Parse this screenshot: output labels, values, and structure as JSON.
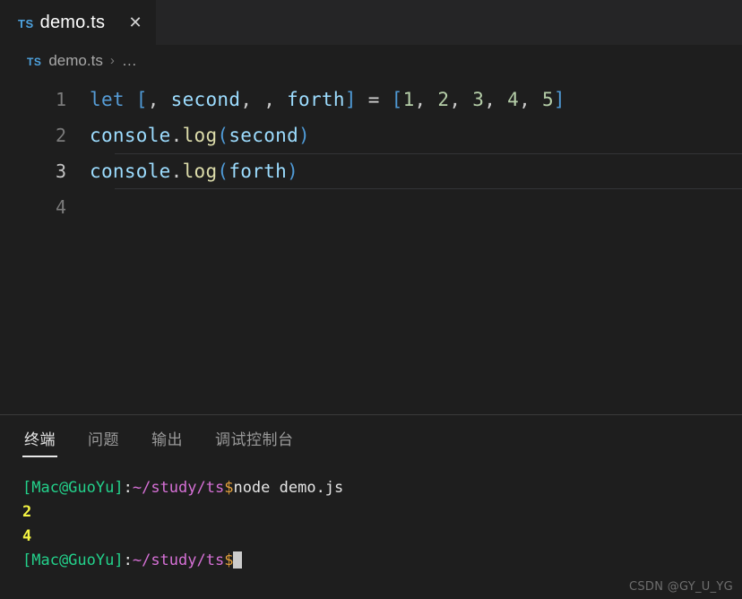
{
  "tabbar": {
    "tabs": [
      {
        "badge": "TS",
        "title": "demo.ts",
        "close": "✕"
      }
    ]
  },
  "breadcrumb": {
    "badge": "TS",
    "file": "demo.ts",
    "separator": "›",
    "more": "…"
  },
  "editor": {
    "lines": [
      {
        "number": "1",
        "active": false,
        "tokens": [
          {
            "text": "let",
            "cls": "tok-kw"
          },
          {
            "text": " ",
            "cls": "tok-op"
          },
          {
            "text": "[",
            "cls": "tok-brk"
          },
          {
            "text": ", ",
            "cls": "tok-punct"
          },
          {
            "text": "second",
            "cls": "tok-var"
          },
          {
            "text": ", , ",
            "cls": "tok-punct"
          },
          {
            "text": "forth",
            "cls": "tok-var"
          },
          {
            "text": "]",
            "cls": "tok-brk"
          },
          {
            "text": " ",
            "cls": "tok-op"
          },
          {
            "text": "=",
            "cls": "tok-op"
          },
          {
            "text": " ",
            "cls": "tok-op"
          },
          {
            "text": "[",
            "cls": "tok-brk"
          },
          {
            "text": "1",
            "cls": "tok-num"
          },
          {
            "text": ", ",
            "cls": "tok-punct"
          },
          {
            "text": "2",
            "cls": "tok-num"
          },
          {
            "text": ", ",
            "cls": "tok-punct"
          },
          {
            "text": "3",
            "cls": "tok-num"
          },
          {
            "text": ", ",
            "cls": "tok-punct"
          },
          {
            "text": "4",
            "cls": "tok-num"
          },
          {
            "text": ", ",
            "cls": "tok-punct"
          },
          {
            "text": "5",
            "cls": "tok-num"
          },
          {
            "text": "]",
            "cls": "tok-brk"
          }
        ]
      },
      {
        "number": "2",
        "active": false,
        "tokens": [
          {
            "text": "console",
            "cls": "tok-var"
          },
          {
            "text": ".",
            "cls": "tok-dot"
          },
          {
            "text": "log",
            "cls": "tok-fn"
          },
          {
            "text": "(",
            "cls": "tok-brk"
          },
          {
            "text": "second",
            "cls": "tok-var"
          },
          {
            "text": ")",
            "cls": "tok-brk"
          }
        ]
      },
      {
        "number": "3",
        "active": true,
        "tokens": [
          {
            "text": "console",
            "cls": "tok-var"
          },
          {
            "text": ".",
            "cls": "tok-dot"
          },
          {
            "text": "log",
            "cls": "tok-fn"
          },
          {
            "text": "(",
            "cls": "tok-brk"
          },
          {
            "text": "forth",
            "cls": "tok-var"
          },
          {
            "text": ")",
            "cls": "tok-brk"
          }
        ]
      },
      {
        "number": "4",
        "active": false,
        "tokens": []
      }
    ]
  },
  "panel": {
    "tabs": [
      {
        "label": "终端",
        "active": true
      },
      {
        "label": "问题",
        "active": false
      },
      {
        "label": "输出",
        "active": false
      },
      {
        "label": "调试控制台",
        "active": false
      }
    ],
    "terminal": {
      "lines": [
        {
          "segments": [
            {
              "text": "[Mac@GuoYu]",
              "cls": "t-green"
            },
            {
              "text": ":",
              "cls": "t-white"
            },
            {
              "text": "~/study/ts",
              "cls": "t-magenta"
            },
            {
              "text": "$",
              "cls": "t-dollar"
            },
            {
              "text": "node demo.js",
              "cls": "t-white"
            }
          ],
          "cursor": false
        },
        {
          "segments": [
            {
              "text": "2",
              "cls": "t-yellow"
            }
          ],
          "cursor": false
        },
        {
          "segments": [
            {
              "text": "4",
              "cls": "t-yellow"
            }
          ],
          "cursor": false
        },
        {
          "segments": [
            {
              "text": "[Mac@GuoYu]",
              "cls": "t-green"
            },
            {
              "text": ":",
              "cls": "t-white"
            },
            {
              "text": "~/study/ts",
              "cls": "t-magenta"
            },
            {
              "text": "$",
              "cls": "t-dollar"
            }
          ],
          "cursor": true
        }
      ]
    }
  },
  "watermark": {
    "text": "CSDN @GY_U_YG"
  },
  "colors": {
    "editor_bg": "#1e1e1e",
    "tabbar_bg": "#252526",
    "keyword": "#569cd6",
    "variable": "#9cdcfe",
    "function": "#dcdcaa",
    "number": "#b5cea8",
    "term_green": "#23d18b",
    "term_magenta": "#d670d6",
    "term_yellow": "#f5f543",
    "term_dollar": "#e5a23c"
  }
}
